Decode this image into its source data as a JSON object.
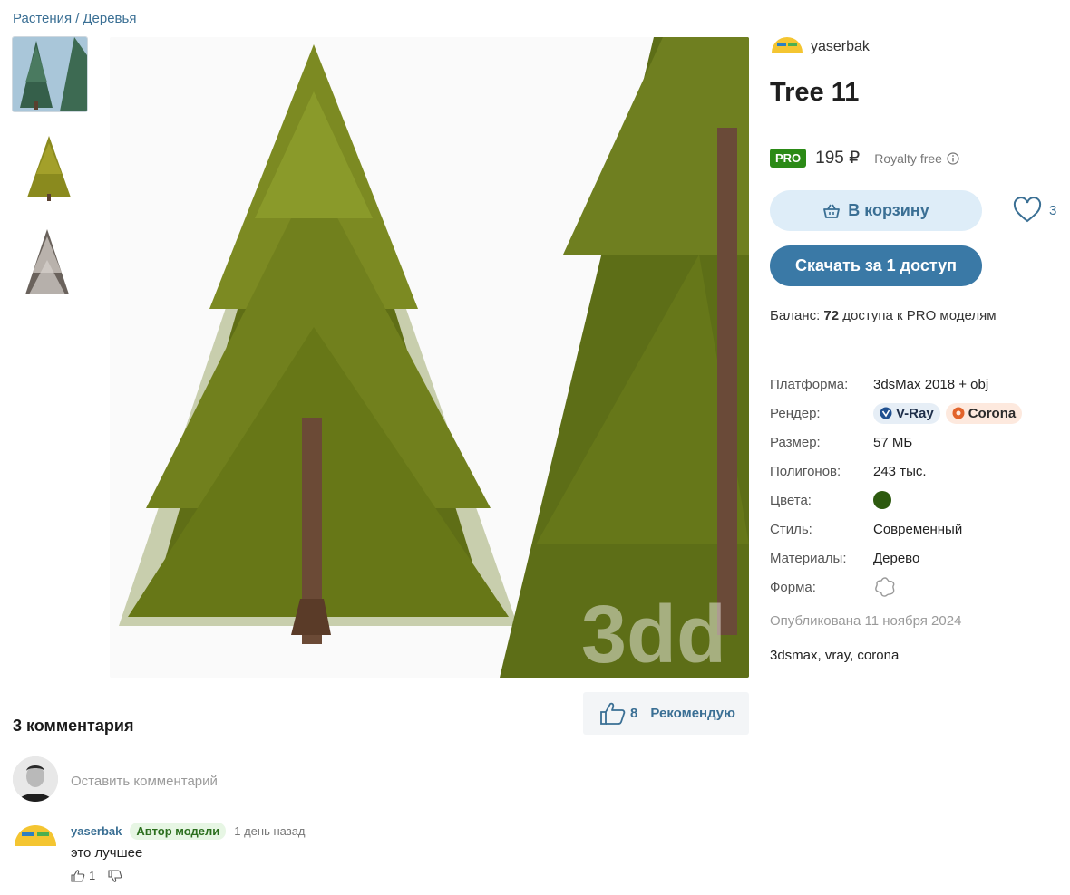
{
  "breadcrumb": {
    "parent": "Растения",
    "separator": "/",
    "current": "Деревья"
  },
  "author": {
    "name": "yaserbak"
  },
  "product": {
    "title": "Tree 11",
    "pro_badge": "PRO",
    "price": "195 ₽",
    "license": "Royalty free",
    "cart_label": "В корзину",
    "likes": "3",
    "download_label": "Скачать за 1 доступ",
    "balance_prefix": "Баланс:",
    "balance_count": "72",
    "balance_suffix": "доступа к PRO моделям"
  },
  "specs": {
    "platform_k": "Платформа:",
    "platform_v": "3dsMax 2018 + obj",
    "render_k": "Рендер:",
    "render_vray": "V-Ray",
    "render_corona": "Corona",
    "size_k": "Размер:",
    "size_v": "57 МБ",
    "polys_k": "Полигонов:",
    "polys_v": "243 тыс.",
    "color_k": "Цвета:",
    "color_v": "#2d5a0f",
    "style_k": "Стиль:",
    "style_v": "Современный",
    "materials_k": "Материалы:",
    "materials_v": "Дерево",
    "shape_k": "Форма:"
  },
  "published": "Опубликована 11 ноября 2024",
  "tags": "3dsmax, vray, corona",
  "recommend": {
    "count": "8",
    "label": "Рекомендую"
  },
  "comments": {
    "title": "3 комментария",
    "placeholder": "Оставить комментарий",
    "items": [
      {
        "author": "yaserbak",
        "badge": "Автор модели",
        "time": "1 день назад",
        "text": "это лучшее",
        "likes": "1"
      }
    ]
  },
  "watermark": "3dd",
  "colors": {
    "accent": "#3a79a6",
    "link": "#3a6f94",
    "pro": "#2b8a16",
    "cart_bg": "#deedf8"
  }
}
